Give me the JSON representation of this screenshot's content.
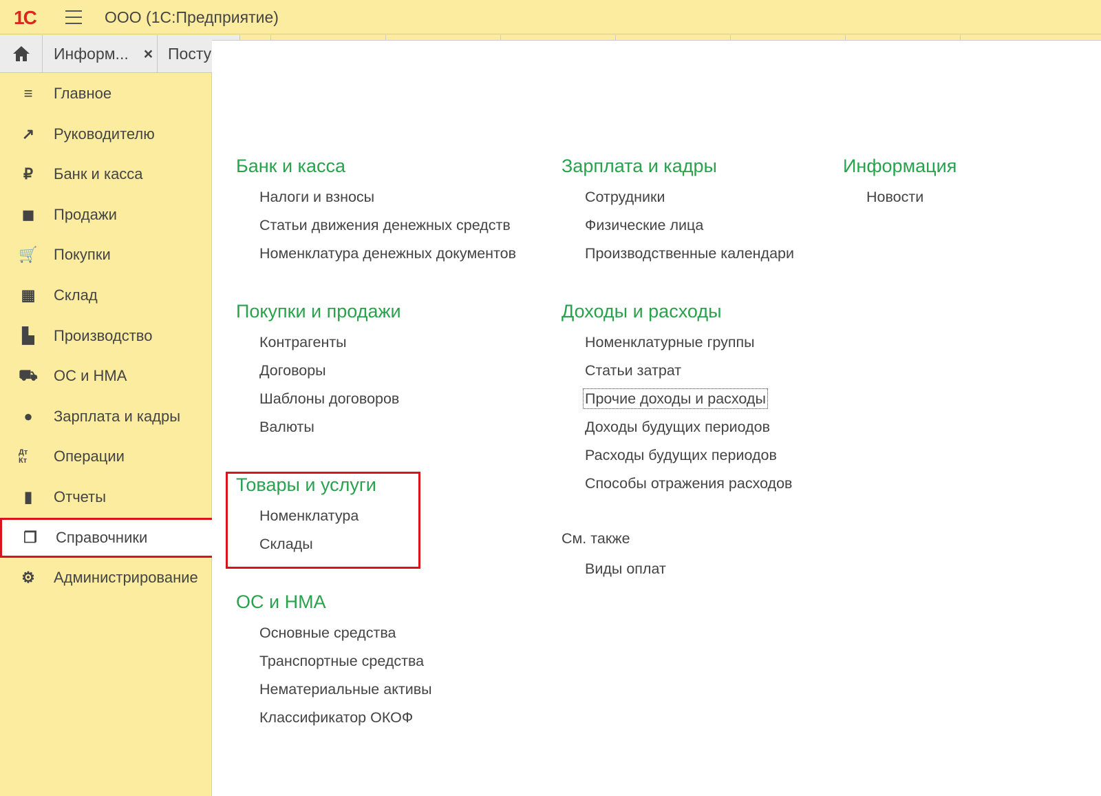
{
  "header": {
    "logo": "1С",
    "title": "ООО  (1С:Предприятие)"
  },
  "tabs": [
    {
      "label": "Информ...",
      "close": "×"
    },
    {
      "label": "Поступ"
    }
  ],
  "sidebar": {
    "items": [
      {
        "label": "Главное",
        "icon": "menu-lines-icon"
      },
      {
        "label": "Руководителю",
        "icon": "trend-icon"
      },
      {
        "label": "Банк и касса",
        "icon": "ruble-icon"
      },
      {
        "label": "Продажи",
        "icon": "bag-icon"
      },
      {
        "label": "Покупки",
        "icon": "cart-icon"
      },
      {
        "label": "Склад",
        "icon": "warehouse-icon"
      },
      {
        "label": "Производство",
        "icon": "factory-icon"
      },
      {
        "label": "ОС и НМА",
        "icon": "truck-icon"
      },
      {
        "label": "Зарплата и кадры",
        "icon": "person-icon"
      },
      {
        "label": "Операции",
        "icon": "dt-kt-icon",
        "glyph": "Дт Кт"
      },
      {
        "label": "Отчеты",
        "icon": "bar-chart-icon"
      },
      {
        "label": "Справочники",
        "icon": "books-icon",
        "active": true
      },
      {
        "label": "Администрирование",
        "icon": "gear-icon"
      }
    ]
  },
  "sections": {
    "bank": {
      "title": "Банк и касса",
      "items": [
        "Налоги и взносы",
        "Статьи движения денежных средств",
        "Номенклатура денежных документов"
      ]
    },
    "purchases": {
      "title": "Покупки и продажи",
      "items": [
        "Контрагенты",
        "Договоры",
        "Шаблоны договоров",
        "Валюты"
      ]
    },
    "goods": {
      "title": "Товары и услуги",
      "items": [
        "Номенклатура",
        "Склады"
      ]
    },
    "os": {
      "title": "ОС и НМА",
      "items": [
        "Основные средства",
        "Транспортные средства",
        "Нематериальные активы",
        "Классификатор ОКОФ"
      ]
    },
    "salary": {
      "title": "Зарплата и кадры",
      "items": [
        "Сотрудники",
        "Физические лица",
        "Производственные календари"
      ]
    },
    "income": {
      "title": "Доходы и расходы",
      "items": [
        "Номенклатурные группы",
        "Статьи затрат",
        "Прочие доходы и расходы",
        "Доходы будущих периодов",
        "Расходы будущих периодов",
        "Способы отражения расходов"
      ]
    },
    "seealso": {
      "title": "См. также",
      "items": [
        "Виды оплат"
      ]
    },
    "info": {
      "title": "Информация",
      "items": [
        "Новости"
      ]
    }
  }
}
